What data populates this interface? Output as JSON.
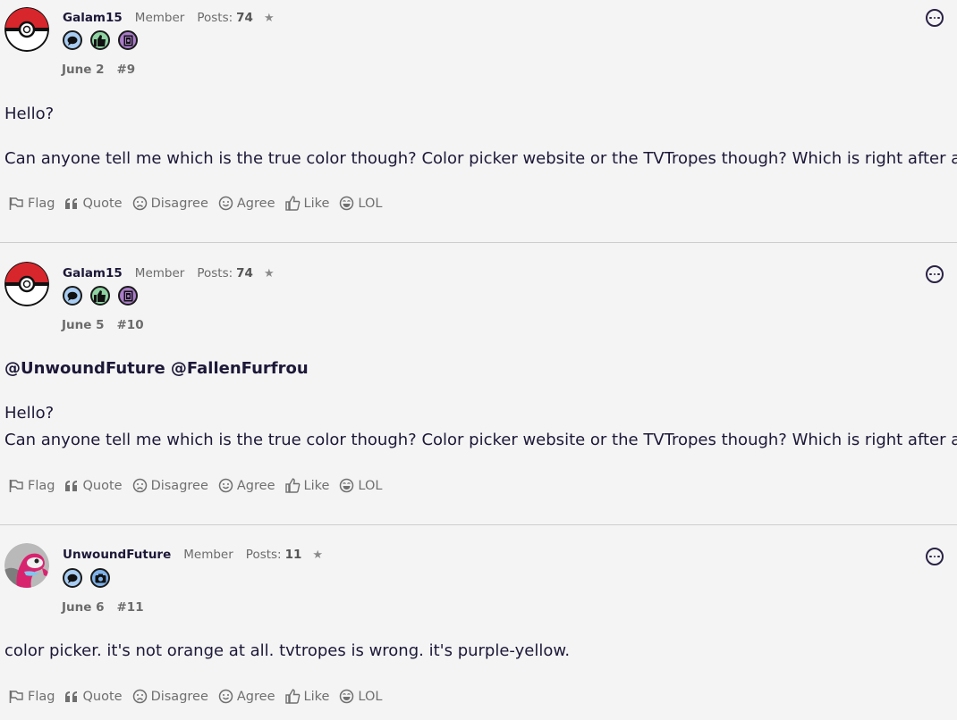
{
  "action_labels": {
    "flag": "Flag",
    "quote": "Quote",
    "disagree": "Disagree",
    "agree": "Agree",
    "like": "Like",
    "lol": "LOL"
  },
  "posts_label": "Posts:",
  "star_glyph": "★",
  "posts": [
    {
      "username": "Galam15",
      "role": "Member",
      "post_count": "74",
      "date": "June 2",
      "number": "#9",
      "mentions": "",
      "paragraphs": [
        "Hello?",
        "Can anyone tell me which is the true color though? Color picker website or the TVTropes though? Which is right after all?"
      ]
    },
    {
      "username": "Galam15",
      "role": "Member",
      "post_count": "74",
      "date": "June 5",
      "number": "#10",
      "mentions": "@UnwoundFuture @FallenFurfrou",
      "paragraphs": [
        "Hello?",
        "Can anyone tell me which is the true color though? Color picker website or the TVTropes though? Which is right after all?"
      ]
    },
    {
      "username": "UnwoundFuture",
      "role": "Member",
      "post_count": "11",
      "date": "June 6",
      "number": "#11",
      "mentions": "",
      "paragraphs": [
        "color picker. it's not orange at all. tvtropes is wrong. it's purple-yellow."
      ]
    }
  ],
  "colors": {
    "badge_chat": "#a9cdf2",
    "badge_like": "#8fd3a2",
    "badge_book": "#a97cc8",
    "badge_camera": "#7fb2ea",
    "text": "#1c1838",
    "muted": "#6b6b6b",
    "separator": "#cdcdcd"
  }
}
